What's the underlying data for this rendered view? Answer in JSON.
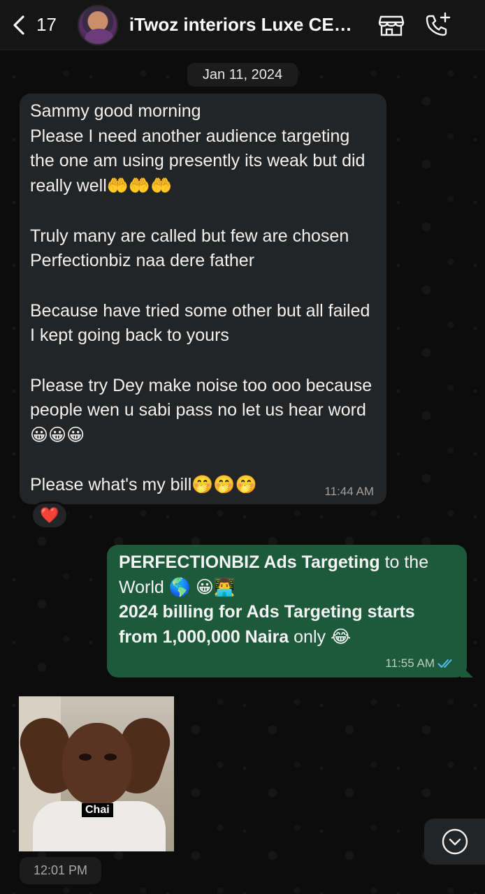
{
  "header": {
    "back_count": "17",
    "contact_name": "iTwoz interiors Luxe CEO...",
    "icons": [
      "back-chevron-icon",
      "avatar",
      "store-icon",
      "add-call-icon"
    ]
  },
  "date_chip": "Jan 11, 2024",
  "incoming_message": {
    "paragraphs": [
      "Sammy good morning\nPlease I need another audience targeting the one am using presently its weak but did really well🤲🤲🤲",
      "Truly many are called but few are chosen Perfectionbiz naa dere father",
      "Because have tried some other but all failed I kept going back to yours",
      "Please try Dey make noise too ooo because people wen u sabi pass no let us hear word 😀😀😀",
      "Please what's my bill🤭🤭🤭"
    ],
    "time": "11:44 AM",
    "reaction": "❤️"
  },
  "outgoing_message": {
    "line1_bold": "PERFECTIONBIZ Ads Targeting",
    "line1_rest": " to the World 🌎 😀👨‍💻",
    "line2_bold": "2024 billing for Ads Targeting  starts from 1,000,000 Naira",
    "line2_rest": " only 😂",
    "time": "11:55 AM",
    "status": "read"
  },
  "sticker": {
    "caption": "Chai",
    "time": "12:01 PM"
  },
  "colors": {
    "incoming_bubble": "#232425",
    "outgoing_bubble": "#1d5a3b",
    "read_ticks": "#53bdeb"
  }
}
